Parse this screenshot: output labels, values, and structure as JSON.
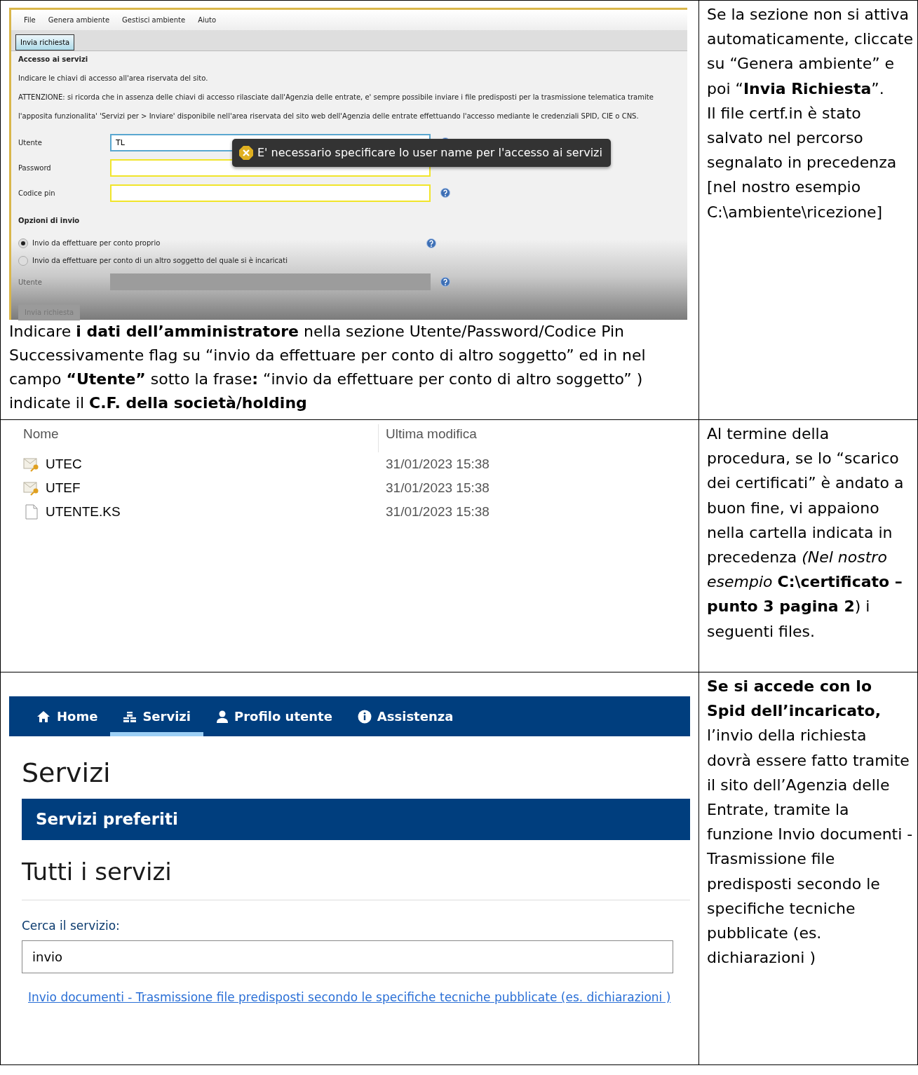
{
  "rows": [
    {
      "kind": "app_screenshot",
      "app": {
        "menu": [
          "File",
          "Genera ambiente",
          "Gestisci ambiente",
          "Aiuto"
        ],
        "tabs": [
          {
            "label": "Invia richiesta",
            "selected": true
          }
        ],
        "section_title": "Accesso ai servizi",
        "intro": "Indicare le chiavi di accesso all'area riservata del sito.",
        "warning": [
          "ATTENZIONE: si ricorda che in assenza delle chiavi di accesso rilasciate dall'Agenzia delle entrate, e' sempre possibile inviare i file predisposti per la trasmissione telematica tramite",
          "l'apposita funzionalita' 'Servizi per > Inviare' disponibile nell'area riservata del sito web dell'Agenzia delle entrate effettuando l'accesso mediante le credenziali SPID, CIE o CNS."
        ],
        "fields": [
          {
            "label": "Utente",
            "value": "TL",
            "focused": true
          },
          {
            "label": "Password",
            "focused": false
          },
          {
            "label": "Codice pin",
            "focused": false
          }
        ],
        "tooltip": "E' necessario specificare lo user name per l'accesso ai servizi",
        "options_title": "Opzioni di invio",
        "options": [
          {
            "label": "Invio da effettuare per conto proprio",
            "selected": true
          },
          {
            "label": "Invio da effettuare per conto di un altro soggetto del quale si è incaricati",
            "selected": false
          }
        ],
        "sub_field": {
          "label": "Utente",
          "disabled": true
        },
        "submit": {
          "label": "Invia richiesta",
          "disabled": true
        }
      },
      "caption": [
        "Indicare **i dati dell’amministratore** nella sezione Utente/Password/Codice Pin",
        "Successivamente flag su “invio da effettuare per conto di altro soggetto”  ed in nel campo **“Utente”** sotto la frase**:** “invio da effettuare per conto di altro soggetto” ) indicate il **C.F. della società/holding**"
      ],
      "note": [
        "Se la sezione non si attiva automaticamente, cliccate su “Genera ambiente” e poi “**Invia Richiesta**”.",
        "Il file certf.in è stato salvato nel percorso segnalato in precedenza [nel nostro esempio C:\\ambiente\\ricezione]"
      ]
    },
    {
      "kind": "file_list",
      "columns": [
        "Nome",
        "Ultima modifica"
      ],
      "files": [
        {
          "name": "UTEC",
          "modified": "31/01/2023 15:38",
          "kind": "certificate"
        },
        {
          "name": "UTEF",
          "modified": "31/01/2023 15:38",
          "kind": "certificate"
        },
        {
          "name": "UTENTE.KS",
          "modified": "31/01/2023 15:38",
          "kind": "file"
        }
      ],
      "note": [
        "Al termine della procedura, se lo “scarico dei certificati” è andato a buon fine, vi appaiono nella cartella indicata in precedenza *(Nel nostro esempio* **C:\\certificato – punto 3 pagina 2**) i seguenti files."
      ]
    },
    {
      "kind": "web_page",
      "nav": [
        {
          "label": "Home",
          "selected": false
        },
        {
          "label": "Servizi",
          "selected": true
        },
        {
          "label": "Profilo utente",
          "selected": false
        },
        {
          "label": "Assistenza",
          "selected": false
        }
      ],
      "title": "Servizi",
      "favorites": "Servizi preferiti",
      "all_title": "Tutti i servizi",
      "search_label": "Cerca il servizio:",
      "search_value": "invio",
      "result_link": "Invio documenti - Trasmissione file predisposti secondo le specifiche tecniche pubblicate (es. dichiarazioni )",
      "note": [
        "**Se si accede con lo Spid dell’incaricato,** l’invio della richiesta dovrà essere fatto tramite il sito dell’Agenzia delle Entrate, tramite la funzione Invio documenti - Trasmissione file predisposti secondo le specifiche tecniche pubblicate (es. dichiarazioni )"
      ]
    }
  ]
}
